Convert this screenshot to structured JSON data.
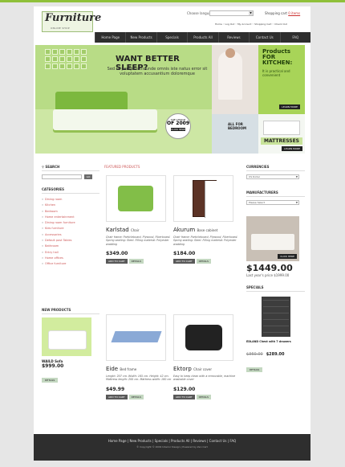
{
  "brand": {
    "logo": "Furniture",
    "tagline": "ONLINE SHOP"
  },
  "header": {
    "lang_label": "Choose language:",
    "cart_label": "Shopping cart",
    "cart_value": "0 items",
    "top_links": "Home ◦ Log Out ◦ My Account ◦ Shopping Cart ◦ Check Out"
  },
  "nav": [
    "Home Page",
    "New Products",
    "Specials",
    "Products All",
    "Reviews",
    "Contact Us",
    "FAQ"
  ],
  "hero": {
    "title": "WANT BETTER SLEEP?",
    "subtitle": "Sed ut perspiciatis unde omnis iste natus error sit voluptatem accusantium doloremque",
    "badge_l1": "THE CHOICE",
    "badge_year": "OF 2009",
    "badge_btn": "CLICK HERE"
  },
  "promo1": {
    "title": "Products FOR KITCHEN:",
    "desc": "It is practical and convenient",
    "more": "LEARN MORE"
  },
  "promo2": {
    "title": "ALL FOR BEDROOM"
  },
  "promo3": {
    "title": "MATTRESSES",
    "more": "LEARN MORE"
  },
  "left": {
    "search_title": "SEARCH",
    "go": "GO",
    "categories_title": "CATEGORIES",
    "categories": [
      "Dining room",
      "Kitchen",
      "Bedroom",
      "Home entertainment",
      "Dining room furniture",
      "Kids furniture",
      "Accessories",
      "Default post Tables",
      "Bathroom",
      "Entry hall",
      "Home offices",
      "Office furniture"
    ],
    "new_title": "NEW PRODUCTS",
    "new_name": "WAILD Sofa",
    "new_price": "$999.00",
    "details": "DETAILS"
  },
  "center": {
    "featured_title": "FEATURED PRODUCTS",
    "products": [
      {
        "name": "Karlstad",
        "type": "Chair",
        "desc": "Chair frame: Particleboard, Plywood, Fiberboard. Spring seating: Steel. Filling material: Polyester wadding",
        "price": "$349.00",
        "add": "ADD TO CART",
        "det": "DETAILS"
      },
      {
        "name": "Akurum",
        "type": "Base cabinet",
        "desc": "Chair frame: Particleboard, Plywood, Fiberboard. Spring seating: Steel. Filling material: Polyester wadding",
        "price": "$184.00",
        "add": "ADD TO CART",
        "det": "DETAILS"
      },
      {
        "name": "Eide",
        "type": "Bed frame",
        "desc": "Length: 207 cm. Width: 165 cm. Height: 42 cm. Mattress length: 200 cm. Mattress width: 160 cm",
        "price": "$49.99",
        "add": "ADD TO CART",
        "det": "DETAILS"
      },
      {
        "name": "Ektorp",
        "type": "Chair cover",
        "desc": "Easy to keep clean with a removable, machine washable cover",
        "price": "$129.00",
        "add": "ADD TO CART",
        "det": "DETAILS"
      }
    ]
  },
  "right": {
    "currencies_title": "CURRENCIES",
    "currency": "US Dollar",
    "manufacturers_title": "MANUFACTURERS",
    "manufacturer": "Please Select",
    "click_here": "CLICK HERE",
    "big_price": "$1449.00",
    "last_price": "Last year's price $1999.00",
    "specials_title": "SPECIALS",
    "special_name": "EDLAND Chest with 7 drawers",
    "old_price": "$360.00",
    "new_price": "$289.00",
    "details": "DETAILS"
  },
  "footer": {
    "links": "Home Page | New Products | Specials | Products All | Reviews | Contact Us | FAQ",
    "copy": "© Copyright © 2009 Interior Design | Powered by Zen Cart"
  }
}
